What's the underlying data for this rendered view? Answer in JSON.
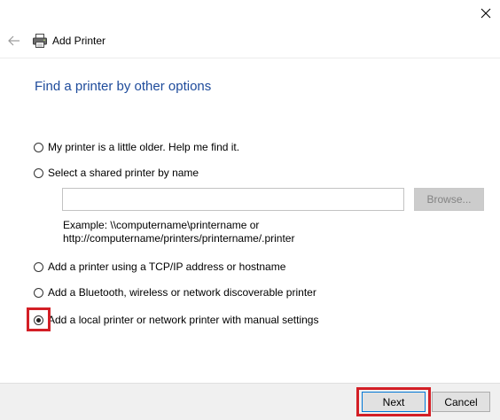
{
  "window": {
    "title": "Add Printer",
    "close_icon": "close-icon",
    "back_icon": "back-arrow-icon",
    "printer_icon": "printer-icon"
  },
  "main": {
    "heading": "Find a printer by other options",
    "options": [
      {
        "label": "My printer is a little older. Help me find it.",
        "selected": false
      },
      {
        "label": "Select a shared printer by name",
        "selected": false
      },
      {
        "label": "Add a printer using a TCP/IP address or hostname",
        "selected": false
      },
      {
        "label": "Add a Bluetooth, wireless or network discoverable printer",
        "selected": false
      },
      {
        "label": "Add a local printer or network printer with manual settings",
        "selected": true
      }
    ],
    "shared_printer_input": {
      "value": "",
      "placeholder": ""
    },
    "browse_label": "Browse...",
    "example_line1": "Example: \\\\computername\\printername or",
    "example_line2": "http://computername/printers/printername/.printer"
  },
  "footer": {
    "next_label": "Next",
    "cancel_label": "Cancel"
  },
  "colors": {
    "heading": "#1e4b9b",
    "highlight": "#d31f26",
    "footer_bg": "#f0f0f0",
    "default_button_border": "#0078d7"
  }
}
